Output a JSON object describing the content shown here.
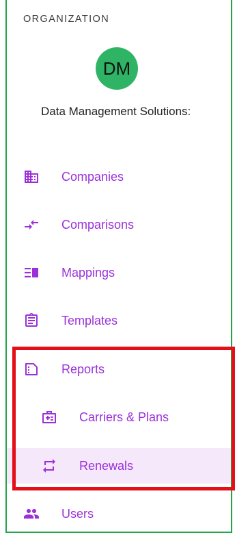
{
  "sidebar": {
    "section_label": "ORGANIZATION",
    "avatar_initials": "DM",
    "org_name": "Data Management Solutions:",
    "items": [
      {
        "label": "Companies",
        "icon": "companies-icon"
      },
      {
        "label": "Comparisons",
        "icon": "comparisons-icon"
      },
      {
        "label": "Mappings",
        "icon": "mappings-icon"
      },
      {
        "label": "Templates",
        "icon": "templates-icon"
      },
      {
        "label": "Reports",
        "icon": "reports-icon"
      },
      {
        "label": "Carriers & Plans",
        "icon": "carriers-plans-icon"
      },
      {
        "label": "Renewals",
        "icon": "renewals-icon",
        "selected": true
      },
      {
        "label": "Users",
        "icon": "users-icon"
      }
    ]
  },
  "colors": {
    "accent": "#9b30d9",
    "avatar": "#2fb466",
    "selected_bg": "#f5e8fb",
    "highlight": "#e3101a",
    "border": "#22a546"
  }
}
